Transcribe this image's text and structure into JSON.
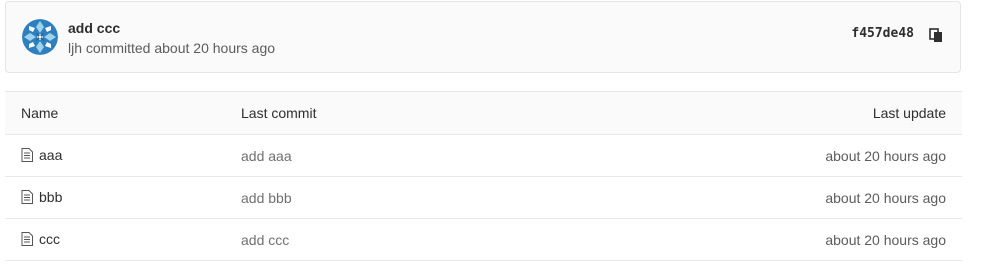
{
  "last_commit": {
    "title": "add ccc",
    "author": "ljh",
    "meta": "ljh committed about 20 hours ago",
    "sha": "f457de48",
    "copy_icon": "copy-icon",
    "avatar_colors": [
      "#2e7fbf",
      "#9fd3ea",
      "#ffffff"
    ]
  },
  "table": {
    "headers": {
      "name": "Name",
      "last_commit": "Last commit",
      "last_update": "Last update"
    },
    "rows": [
      {
        "name": "aaa",
        "icon": "file-text-icon",
        "commit": "add aaa",
        "updated": "about 20 hours ago"
      },
      {
        "name": "bbb",
        "icon": "file-text-icon",
        "commit": "add bbb",
        "updated": "about 20 hours ago"
      },
      {
        "name": "ccc",
        "icon": "file-text-icon",
        "commit": "add ccc",
        "updated": "about 20 hours ago"
      }
    ]
  }
}
